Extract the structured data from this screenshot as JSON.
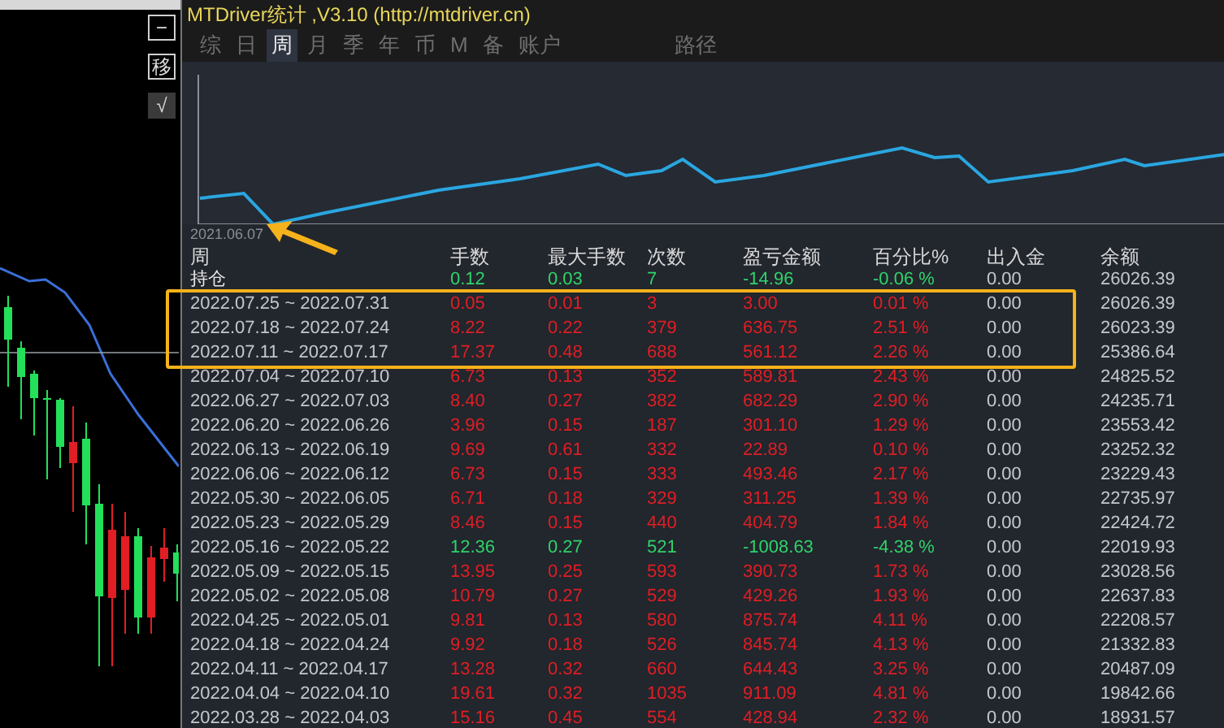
{
  "side_buttons": [
    {
      "label": "−",
      "kind": "outline"
    },
    {
      "label": "移",
      "kind": "outline"
    },
    {
      "label": "√",
      "kind": "filled"
    }
  ],
  "window": {
    "title": "MTDriver统计 ,V3.10 (http://mtdriver.cn)"
  },
  "tabs": [
    {
      "label": "综",
      "selected": false
    },
    {
      "label": "日",
      "selected": false
    },
    {
      "label": "周",
      "selected": true
    },
    {
      "label": "月",
      "selected": false
    },
    {
      "label": "季",
      "selected": false
    },
    {
      "label": "年",
      "selected": false
    },
    {
      "label": "币",
      "selected": false
    },
    {
      "label": "M",
      "selected": false
    },
    {
      "label": "备",
      "selected": false
    },
    {
      "label": "账户",
      "selected": false
    }
  ],
  "path_label": "路径",
  "chart_start_date": "2021.06.07",
  "table": {
    "columns": [
      "周",
      "手数",
      "最大手数",
      "次数",
      "盈亏金额",
      "百分比%",
      "出入金",
      "余额"
    ],
    "rows": [
      {
        "cells": [
          "持仓",
          "0.12",
          "0.03",
          "7",
          "-14.96",
          "-0.06 %",
          "0.00",
          "26026.39"
        ],
        "color": "#2fd36a",
        "highlighted": false
      },
      {
        "cells": [
          "2022.07.25 ~ 2022.07.31",
          "0.05",
          "0.01",
          "3",
          "3.00",
          "0.01 %",
          "0.00",
          "26026.39"
        ],
        "color": "#e01e24",
        "highlighted": true
      },
      {
        "cells": [
          "2022.07.18 ~ 2022.07.24",
          "8.22",
          "0.22",
          "379",
          "636.75",
          "2.51 %",
          "0.00",
          "26023.39"
        ],
        "color": "#e01e24",
        "highlighted": true
      },
      {
        "cells": [
          "2022.07.11 ~ 2022.07.17",
          "17.37",
          "0.48",
          "688",
          "561.12",
          "2.26 %",
          "0.00",
          "25386.64"
        ],
        "color": "#e01e24",
        "highlighted": true
      },
      {
        "cells": [
          "2022.07.04 ~ 2022.07.10",
          "6.73",
          "0.13",
          "352",
          "589.81",
          "2.43 %",
          "0.00",
          "24825.52"
        ],
        "color": "#e01e24",
        "highlighted": false
      },
      {
        "cells": [
          "2022.06.27 ~ 2022.07.03",
          "8.40",
          "0.27",
          "382",
          "682.29",
          "2.90 %",
          "0.00",
          "24235.71"
        ],
        "color": "#e01e24",
        "highlighted": false
      },
      {
        "cells": [
          "2022.06.20 ~ 2022.06.26",
          "3.96",
          "0.15",
          "187",
          "301.10",
          "1.29 %",
          "0.00",
          "23553.42"
        ],
        "color": "#e01e24",
        "highlighted": false
      },
      {
        "cells": [
          "2022.06.13 ~ 2022.06.19",
          "9.69",
          "0.61",
          "332",
          "22.89",
          "0.10 %",
          "0.00",
          "23252.32"
        ],
        "color": "#e01e24",
        "highlighted": false
      },
      {
        "cells": [
          "2022.06.06 ~ 2022.06.12",
          "6.73",
          "0.15",
          "333",
          "493.46",
          "2.17 %",
          "0.00",
          "23229.43"
        ],
        "color": "#e01e24",
        "highlighted": false
      },
      {
        "cells": [
          "2022.05.30 ~ 2022.06.05",
          "6.71",
          "0.18",
          "329",
          "311.25",
          "1.39 %",
          "0.00",
          "22735.97"
        ],
        "color": "#e01e24",
        "highlighted": false
      },
      {
        "cells": [
          "2022.05.23 ~ 2022.05.29",
          "8.46",
          "0.15",
          "440",
          "404.79",
          "1.84 %",
          "0.00",
          "22424.72"
        ],
        "color": "#e01e24",
        "highlighted": false
      },
      {
        "cells": [
          "2022.05.16 ~ 2022.05.22",
          "12.36",
          "0.27",
          "521",
          "-1008.63",
          "-4.38 %",
          "0.00",
          "22019.93"
        ],
        "color": "#2fd36a",
        "highlighted": false
      },
      {
        "cells": [
          "2022.05.09 ~ 2022.05.15",
          "13.95",
          "0.25",
          "593",
          "390.73",
          "1.73 %",
          "0.00",
          "23028.56"
        ],
        "color": "#e01e24",
        "highlighted": false
      },
      {
        "cells": [
          "2022.05.02 ~ 2022.05.08",
          "10.79",
          "0.27",
          "529",
          "429.26",
          "1.93 %",
          "0.00",
          "22637.83"
        ],
        "color": "#e01e24",
        "highlighted": false
      },
      {
        "cells": [
          "2022.04.25 ~ 2022.05.01",
          "9.81",
          "0.13",
          "580",
          "875.74",
          "4.11 %",
          "0.00",
          "22208.57"
        ],
        "color": "#e01e24",
        "highlighted": false
      },
      {
        "cells": [
          "2022.04.18 ~ 2022.04.24",
          "9.92",
          "0.18",
          "526",
          "845.74",
          "4.13 %",
          "0.00",
          "21332.83"
        ],
        "color": "#e01e24",
        "highlighted": false
      },
      {
        "cells": [
          "2022.04.11 ~ 2022.04.17",
          "13.28",
          "0.32",
          "660",
          "644.43",
          "3.25 %",
          "0.00",
          "20487.09"
        ],
        "color": "#e01e24",
        "highlighted": false
      },
      {
        "cells": [
          "2022.04.04 ~ 2022.04.10",
          "19.61",
          "0.32",
          "1035",
          "911.09",
          "4.81 %",
          "0.00",
          "19842.66"
        ],
        "color": "#e01e24",
        "highlighted": false
      },
      {
        "cells": [
          "2022.03.28 ~ 2022.04.03",
          "15.16",
          "0.45",
          "554",
          "428.94",
          "2.32 %",
          "0.00",
          "18931.57"
        ],
        "color": "#e01e24",
        "highlighted": false
      }
    ]
  }
}
